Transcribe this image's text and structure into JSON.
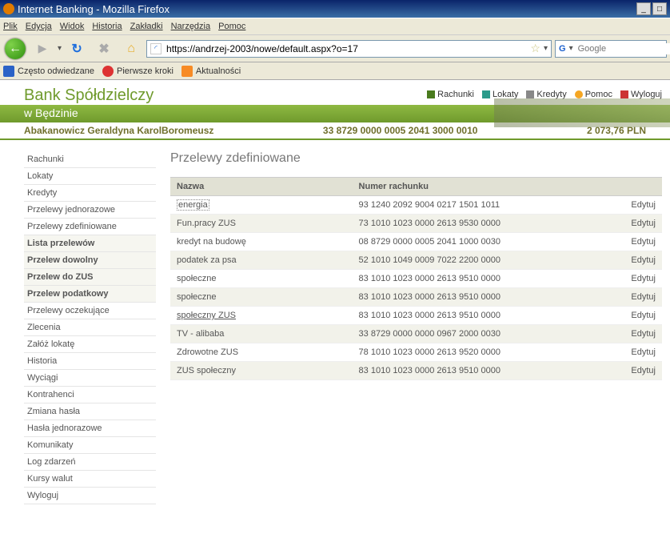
{
  "browser": {
    "title": "Internet Banking - Mozilla Firefox",
    "menu": [
      "Plik",
      "Edycja",
      "Widok",
      "Historia",
      "Zakładki",
      "Narzędzia",
      "Pomoc"
    ],
    "url": "https://andrzej-2003/nowe/default.aspx?o=17",
    "search_placeholder": "Google",
    "bookmarks": [
      "Często odwiedzane",
      "Pierwsze kroki",
      "Aktualności"
    ],
    "winbuttons": {
      "min": "_",
      "max": "□"
    }
  },
  "bank": {
    "name": "Bank Spółdzielczy",
    "branch": "w Będzinie",
    "topnav": [
      {
        "icon": "green",
        "label": "Rachunki"
      },
      {
        "icon": "teal",
        "label": "Lokaty"
      },
      {
        "icon": "gray",
        "label": "Kredyty"
      },
      {
        "icon": "orange",
        "label": "Pomoc"
      },
      {
        "icon": "red",
        "label": "Wyloguj"
      }
    ],
    "owner": "Abakanowicz Geraldyna KarolBoromeusz",
    "account": "33 8729 0000 0005 2041 3000 0010",
    "balance": "2 073,76 PLN"
  },
  "sidebar": {
    "items": [
      {
        "label": "Rachunki",
        "bold": false
      },
      {
        "label": "Lokaty",
        "bold": false
      },
      {
        "label": "Kredyty",
        "bold": false
      },
      {
        "label": "Przelewy jednorazowe",
        "bold": false
      },
      {
        "label": "Przelewy zdefiniowane",
        "bold": false
      },
      {
        "label": "Lista przelewów",
        "bold": true
      },
      {
        "label": "Przelew dowolny",
        "bold": true
      },
      {
        "label": "Przelew do ZUS",
        "bold": true
      },
      {
        "label": "Przelew podatkowy",
        "bold": true
      },
      {
        "label": "Przelewy oczekujące",
        "bold": false
      },
      {
        "label": "Zlecenia",
        "bold": false
      },
      {
        "label": "Załóż lokatę",
        "bold": false
      },
      {
        "label": "Historia",
        "bold": false
      },
      {
        "label": "Wyciągi",
        "bold": false
      },
      {
        "label": "Kontrahenci",
        "bold": false
      },
      {
        "label": "Zmiana hasła",
        "bold": false
      },
      {
        "label": "Hasła jednorazowe",
        "bold": false
      },
      {
        "label": "Komunikaty",
        "bold": false
      },
      {
        "label": "Log zdarzeń",
        "bold": false
      },
      {
        "label": "Kursy walut",
        "bold": false
      },
      {
        "label": "Wyloguj",
        "bold": false
      }
    ]
  },
  "main": {
    "title": "Przelewy zdefiniowane",
    "columns": {
      "name": "Nazwa",
      "acct": "Numer rachunku",
      "edit": ""
    },
    "edit_label": "Edytuj",
    "rows": [
      {
        "name": "energia",
        "acct": "93 1240 2092 9004 0217 1501 1011",
        "boxed": true
      },
      {
        "name": "Fun.pracy ZUS",
        "acct": "73 1010 1023 0000 2613 9530 0000"
      },
      {
        "name": "kredyt na budowę",
        "acct": "08 8729 0000 0005 2041 1000 0030"
      },
      {
        "name": "podatek za psa",
        "acct": "52 1010 1049 0009 7022 2200 0000"
      },
      {
        "name": "społeczne",
        "acct": "83 1010 1023 0000 2613 9510 0000"
      },
      {
        "name": "społeczne",
        "acct": "83 1010 1023 0000 2613 9510 0000"
      },
      {
        "name": "społeczny ZUS",
        "acct": "83 1010 1023 0000 2613 9510 0000",
        "uline": true
      },
      {
        "name": "TV - alibaba",
        "acct": "33 8729 0000 0000 0967 2000 0030"
      },
      {
        "name": "Zdrowotne ZUS",
        "acct": "78 1010 1023 0000 2613 9520 0000"
      },
      {
        "name": "ZUS społeczny",
        "acct": "83 1010 1023 0000 2613 9510 0000"
      }
    ]
  }
}
